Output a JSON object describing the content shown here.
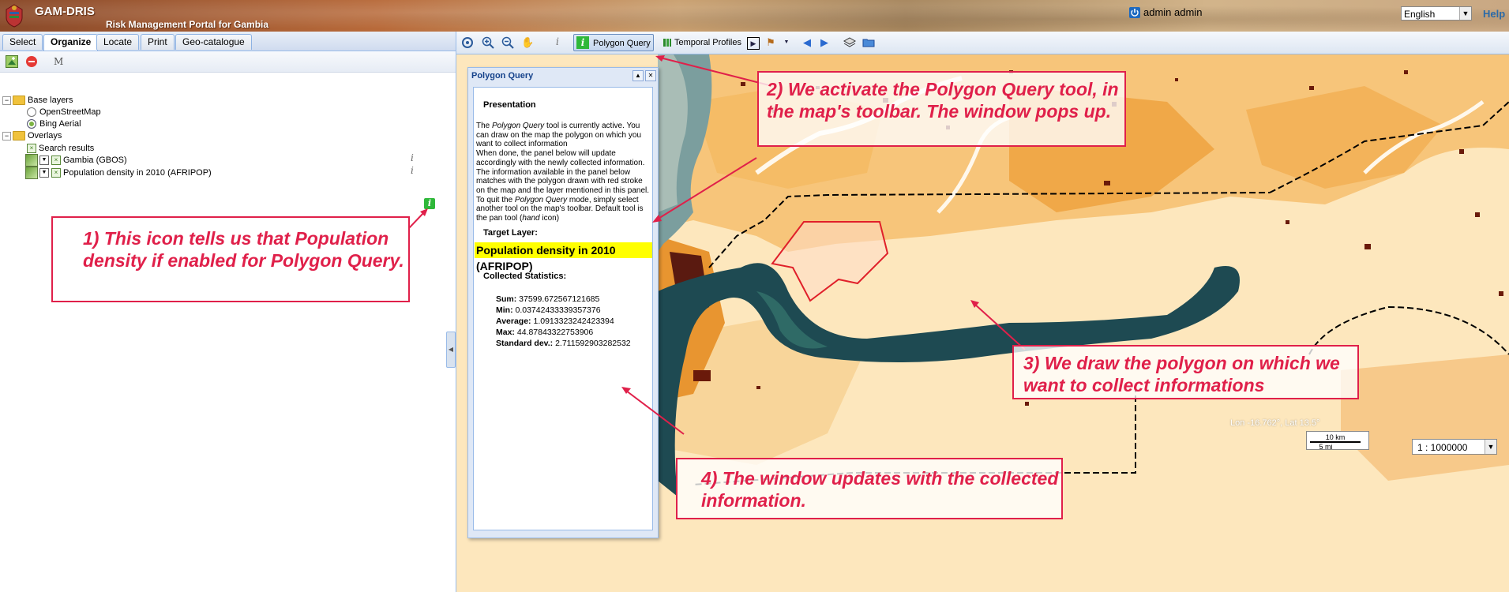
{
  "header": {
    "app_title": "GAM-DRIS",
    "app_subtitle": "Risk Management Portal for Gambia",
    "user": "admin admin",
    "language": "English",
    "help": "Help"
  },
  "left_panel": {
    "tabs": [
      {
        "label": "Select",
        "active": false
      },
      {
        "label": "Organize",
        "active": true
      },
      {
        "label": "Locate",
        "active": false
      },
      {
        "label": "Print",
        "active": false
      },
      {
        "label": "Geo-catalogue",
        "active": false
      }
    ],
    "toolbar": {
      "add_icon": "add-layer-icon",
      "remove_icon": "remove-layer-icon",
      "m_label": "M"
    },
    "tree": {
      "base_layers": "Base layers",
      "osm": "OpenStreetMap",
      "bing": "Bing Aerial",
      "overlays": "Overlays",
      "search_results": "Search results",
      "gambia": "Gambia (GBOS)",
      "popdens": "Population density in 2010 (AFRIPOP)"
    }
  },
  "map_toolbar": {
    "polygon_query": "Polygon Query",
    "temporal_profiles": "Temporal Profiles"
  },
  "pq_window": {
    "title": "Polygon Query",
    "presentation_title": "Presentation",
    "p1a": "The ",
    "p1b": "Polygon Query",
    "p1c": " tool is currently active. You can draw on the map the polygon on which you want to collect information",
    "p2": "When done, the panel below will update accordingly with the newly collected information. The information available in the panel below matches with the polygon drawn with red stroke on the map and the layer mentioned in this panel.",
    "p3a": "To quit the ",
    "p3b": "Polygon Query",
    "p3c": " mode, simply select another tool on the map's toolbar. Default tool is the pan tool (",
    "p3d": "hand",
    "p3e": " icon)",
    "target_layer_title": "Target Layer:",
    "target_layer": "Population density in 2010 (AFRIPOP)",
    "collected_title": "Collected Statistics:",
    "stats": {
      "sum_label": "Sum:",
      "sum": "37599.672567121685",
      "min_label": "Min:",
      "min": "0.03742433339357376",
      "avg_label": "Average:",
      "avg": "1.0913323242423394",
      "max_label": "Max:",
      "max": "44.87843322753906",
      "std_label": "Standard dev.:",
      "std": "2.711592903282532"
    }
  },
  "map_footer": {
    "scale_km": "10 km",
    "scale_mi": "5 mi",
    "scale": "1 : 1000000",
    "coords": "Lon -16.762°, Lat 13.5°"
  },
  "annotations": {
    "a1": "1) This icon tells us that Population density if enabled for Polygon Query.",
    "a2": "2) We activate the Polygon Query tool, in the map's toolbar. The window pops up.",
    "a3": "3) We draw the polygon on which we want to collect informations",
    "a4": "4) The window updates with the collected information."
  },
  "colors": {
    "annotation": "#e0204a",
    "highlight": "#ffff00",
    "active_tool": "#2fb83a"
  }
}
